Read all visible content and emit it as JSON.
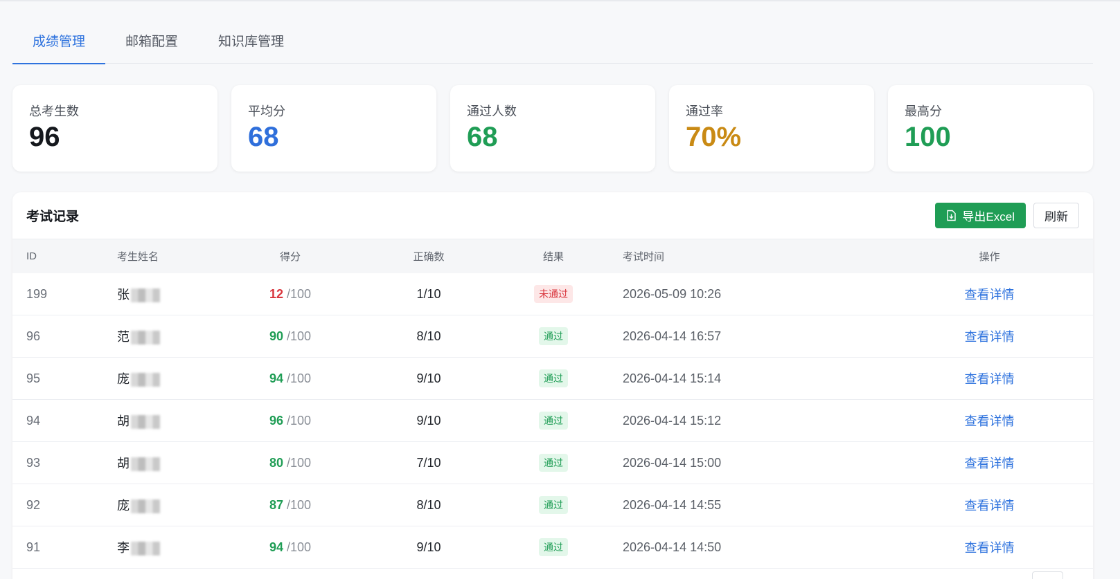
{
  "tabs": [
    {
      "label": "成绩管理",
      "active": true
    },
    {
      "label": "邮箱配置",
      "active": false
    },
    {
      "label": "知识库管理",
      "active": false
    }
  ],
  "stats": [
    {
      "label": "总考生数",
      "value": "96",
      "color": "#15181d"
    },
    {
      "label": "平均分",
      "value": "68",
      "color": "#2f6fdb"
    },
    {
      "label": "通过人数",
      "value": "68",
      "color": "#1f9d55"
    },
    {
      "label": "通过率",
      "value": "70%",
      "color": "#c98a14"
    },
    {
      "label": "最高分",
      "value": "100",
      "color": "#1f9d55"
    }
  ],
  "records": {
    "title": "考试记录",
    "export_label": "导出Excel",
    "refresh_label": "刷新",
    "columns": {
      "id": "ID",
      "name": "考生姓名",
      "score": "得分",
      "correct": "正确数",
      "result": "结果",
      "time": "考试时间",
      "op": "操作"
    },
    "rows": [
      {
        "id": "199",
        "name": "张",
        "score": "12",
        "total": "/100",
        "correct": "1/10",
        "result": "未通过",
        "passed": false,
        "time": "2026-05-09 10:26",
        "action": "查看详情"
      },
      {
        "id": "96",
        "name": "范",
        "score": "90",
        "total": "/100",
        "correct": "8/10",
        "result": "通过",
        "passed": true,
        "time": "2026-04-14 16:57",
        "action": "查看详情"
      },
      {
        "id": "95",
        "name": "庞",
        "score": "94",
        "total": "/100",
        "correct": "9/10",
        "result": "通过",
        "passed": true,
        "time": "2026-04-14 15:14",
        "action": "查看详情"
      },
      {
        "id": "94",
        "name": "胡",
        "score": "96",
        "total": "/100",
        "correct": "9/10",
        "result": "通过",
        "passed": true,
        "time": "2026-04-14 15:12",
        "action": "查看详情"
      },
      {
        "id": "93",
        "name": "胡",
        "score": "80",
        "total": "/100",
        "correct": "7/10",
        "result": "通过",
        "passed": true,
        "time": "2026-04-14 15:00",
        "action": "查看详情"
      },
      {
        "id": "92",
        "name": "庞",
        "score": "87",
        "total": "/100",
        "correct": "8/10",
        "result": "通过",
        "passed": true,
        "time": "2026-04-14 14:55",
        "action": "查看详情"
      },
      {
        "id": "91",
        "name": "李",
        "score": "94",
        "total": "/100",
        "correct": "9/10",
        "result": "通过",
        "passed": true,
        "time": "2026-04-14 14:50",
        "action": "查看详情"
      }
    ]
  },
  "colors": {
    "pass": "#1f9d55",
    "fail": "#d9363e",
    "accent": "#2f73de"
  }
}
